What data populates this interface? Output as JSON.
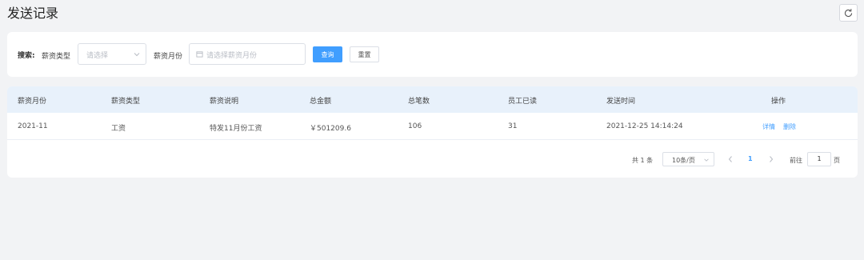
{
  "header": {
    "title": "发送记录",
    "refresh_icon": "refresh-icon"
  },
  "search": {
    "label_search": "搜索:",
    "label_type": "薪资类型",
    "type_placeholder": "请选择",
    "label_month": "薪资月份",
    "month_placeholder": "请选择薪资月份",
    "query_button": "查询",
    "reset_button": "重置"
  },
  "table": {
    "columns": [
      "薪资月份",
      "薪资类型",
      "薪资说明",
      "总金额",
      "总笔数",
      "员工已读",
      "发送时间",
      "操作"
    ],
    "rows": [
      {
        "month": "2021-11",
        "type": "工资",
        "desc": "特发11月份工资",
        "amount": "￥501209.6",
        "count": "106",
        "read": "31",
        "sent_time": "2021-12-25 14:14:24",
        "action_detail": "详情",
        "action_delete": "删除"
      }
    ]
  },
  "pagination": {
    "total_text": "共 1 条",
    "page_size": "10条/页",
    "current_page": "1",
    "goto_label": "前往",
    "goto_value": "1",
    "page_suffix": "页"
  },
  "colors": {
    "primary": "#409eff",
    "header_bg": "#e8f1fb",
    "page_bg": "#f2f3f5"
  }
}
